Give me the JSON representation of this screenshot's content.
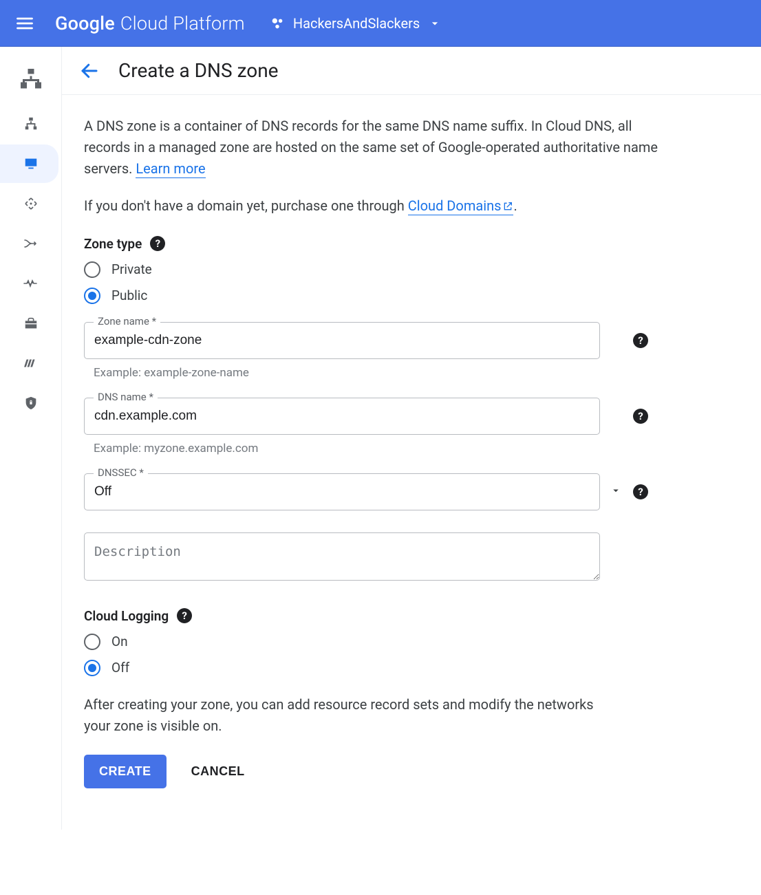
{
  "header": {
    "logo_g": "Google",
    "logo_rest": "Cloud Platform",
    "project": "HackersAndSlackers"
  },
  "page": {
    "title": "Create a DNS zone",
    "intro_pre": "A DNS zone is a container of DNS records for the same DNS name suffix. In Cloud DNS, all records in a managed zone are hosted on the same set of Google-operated authoritative name servers. ",
    "learn_more": "Learn more",
    "subintro_pre": "If you don't have a domain yet, purchase one through ",
    "cloud_domains": "Cloud Domains",
    "subintro_post": "."
  },
  "zone_type": {
    "label": "Zone type",
    "options": {
      "private": "Private",
      "public": "Public"
    },
    "selected": "public"
  },
  "zone_name": {
    "label": "Zone name *",
    "value": "example-cdn-zone",
    "helper": "Example: example-zone-name"
  },
  "dns_name": {
    "label": "DNS name *",
    "value": "cdn.example.com",
    "helper": "Example: myzone.example.com"
  },
  "dnssec": {
    "label": "DNSSEC *",
    "value": "Off"
  },
  "description": {
    "placeholder": "Description",
    "value": ""
  },
  "cloud_logging": {
    "label": "Cloud Logging",
    "options": {
      "on": "On",
      "off": "Off"
    },
    "selected": "off"
  },
  "post_note": "After creating your zone, you can add resource record sets and modify the networks your zone is visible on.",
  "actions": {
    "create": "CREATE",
    "cancel": "CANCEL"
  }
}
